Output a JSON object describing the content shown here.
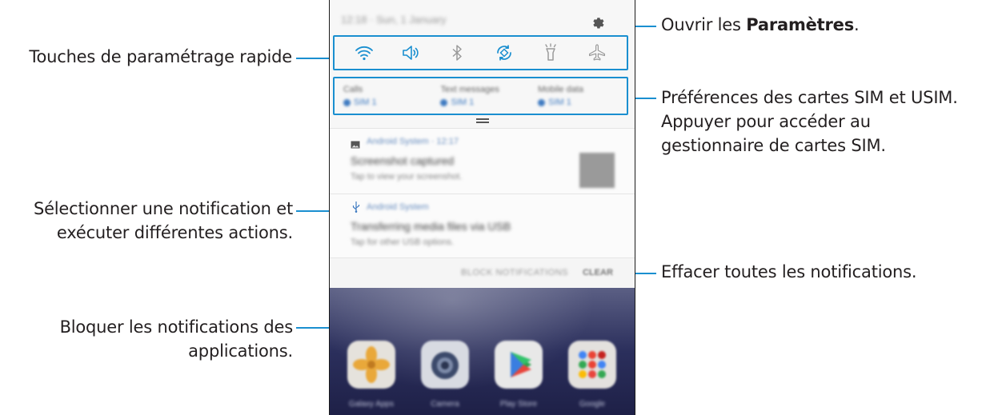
{
  "callouts": {
    "quick_settings": "Touches de paramétrage rapide",
    "settings_prefix": "Ouvrir les ",
    "settings_bold": "Paramètres",
    "settings_suffix": ".",
    "sim_line1": "Préférences des cartes SIM et USIM.",
    "sim_line2": "Appuyer pour accéder au",
    "sim_line3": "gestionnaire de cartes SIM.",
    "select_line1": "Sélectionner une notification et",
    "select_line2": "exécuter différentes actions.",
    "clear_all": "Effacer toutes les notifications.",
    "block_line1": "Bloquer les notifications des",
    "block_line2": "applications."
  },
  "colors": {
    "accent": "#1a8fd0"
  },
  "phone": {
    "status_text": "12:18 · Sun, 1 January",
    "settings_icon": "gear-icon",
    "quick_icons": [
      "wifi-icon",
      "sound-icon",
      "bluetooth-icon",
      "auto-rotate-icon",
      "flashlight-icon",
      "airplane-mode-icon"
    ],
    "sim_prefs": [
      {
        "title": "Calls",
        "sim": "SIM 1"
      },
      {
        "title": "Text messages",
        "sim": "SIM 1"
      },
      {
        "title": "Mobile data",
        "sim": "SIM 1"
      }
    ],
    "notifications": [
      {
        "icon": "image-icon",
        "app": "Android System · 12:17",
        "title": "Screenshot captured",
        "text": "Tap to view your screenshot."
      },
      {
        "icon": "usb-icon",
        "app": "Android System",
        "title": "Transferring media files via USB",
        "text": "Tap for other USB options."
      }
    ],
    "block_label": "BLOCK NOTIFICATIONS",
    "clear_label": "CLEAR",
    "home_apps": [
      "Galaxy Apps",
      "Camera",
      "Play Store",
      "Google"
    ]
  }
}
